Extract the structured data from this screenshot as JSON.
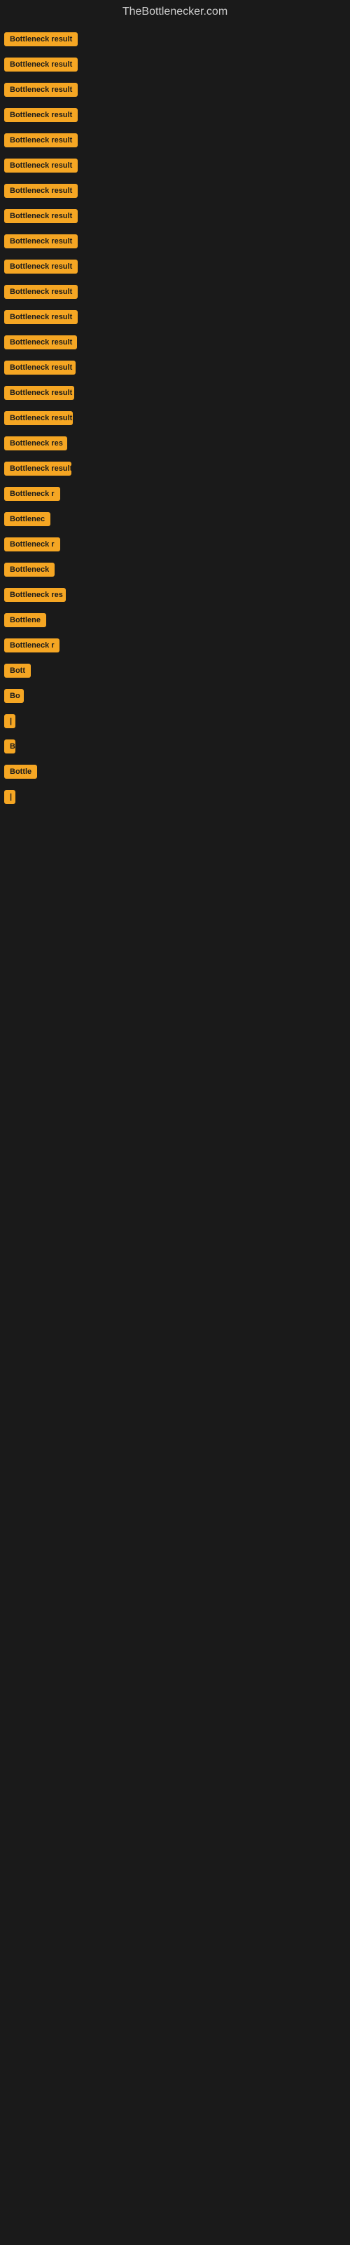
{
  "site": {
    "title": "TheBottlenecker.com"
  },
  "items": [
    {
      "label": "Bottleneck result",
      "width": 130
    },
    {
      "label": "Bottleneck result",
      "width": 128
    },
    {
      "label": "Bottleneck result",
      "width": 125
    },
    {
      "label": "Bottleneck result",
      "width": 122
    },
    {
      "label": "Bottleneck result",
      "width": 120
    },
    {
      "label": "Bottleneck result",
      "width": 118
    },
    {
      "label": "Bottleneck result",
      "width": 116
    },
    {
      "label": "Bottleneck result",
      "width": 114
    },
    {
      "label": "Bottleneck result",
      "width": 112
    },
    {
      "label": "Bottleneck result",
      "width": 110
    },
    {
      "label": "Bottleneck result",
      "width": 108
    },
    {
      "label": "Bottleneck result",
      "width": 106
    },
    {
      "label": "Bottleneck result",
      "width": 104
    },
    {
      "label": "Bottleneck result",
      "width": 102
    },
    {
      "label": "Bottleneck result",
      "width": 100
    },
    {
      "label": "Bottleneck result",
      "width": 98
    },
    {
      "label": "Bottleneck res",
      "width": 90
    },
    {
      "label": "Bottleneck result",
      "width": 96
    },
    {
      "label": "Bottleneck r",
      "width": 82
    },
    {
      "label": "Bottlenec",
      "width": 74
    },
    {
      "label": "Bottleneck r",
      "width": 80
    },
    {
      "label": "Bottleneck",
      "width": 78
    },
    {
      "label": "Bottleneck res",
      "width": 88
    },
    {
      "label": "Bottlene",
      "width": 68
    },
    {
      "label": "Bottleneck r",
      "width": 79
    },
    {
      "label": "Bott",
      "width": 42
    },
    {
      "label": "Bo",
      "width": 28
    },
    {
      "label": "|",
      "width": 10
    },
    {
      "label": "B",
      "width": 16
    },
    {
      "label": "Bottle",
      "width": 50
    },
    {
      "label": "|",
      "width": 8
    }
  ],
  "colors": {
    "badge_bg": "#f5a623",
    "badge_text": "#1a1a1a",
    "site_title": "#cccccc",
    "background": "#1a1a1a"
  }
}
